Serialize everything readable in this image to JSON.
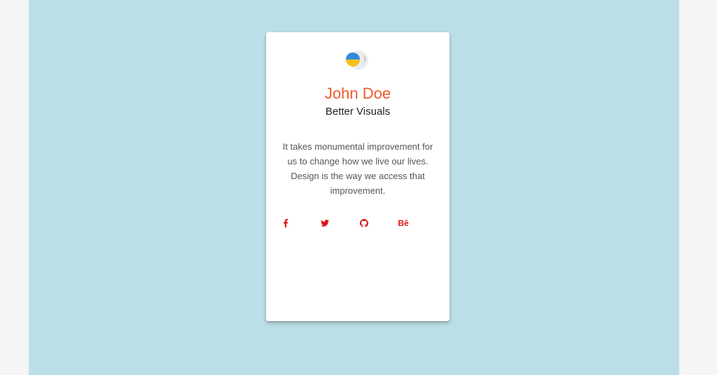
{
  "profile": {
    "name": "John Doe",
    "title": "Better Visuals",
    "bio": "It takes monumental improvement for us to change how we live our lives. Design is the way we access that improvement."
  },
  "avatar": {
    "icon": "ukraine-flag-avatar-icon",
    "top_color": "#2f8cdc",
    "bottom_color": "#f4c21b"
  },
  "social_links": [
    {
      "icon": "facebook-icon",
      "glyph": "f"
    },
    {
      "icon": "twitter-icon",
      "glyph": "bird"
    },
    {
      "icon": "github-icon",
      "glyph": "octocat"
    },
    {
      "icon": "behance-icon",
      "glyph": "Bē"
    }
  ],
  "colors": {
    "page_background": "#f5f5f5",
    "stage_background": "#bcdfe7",
    "card_background": "#ffffff",
    "name_color": "#ee5a2b",
    "social_color": "#e01418"
  }
}
